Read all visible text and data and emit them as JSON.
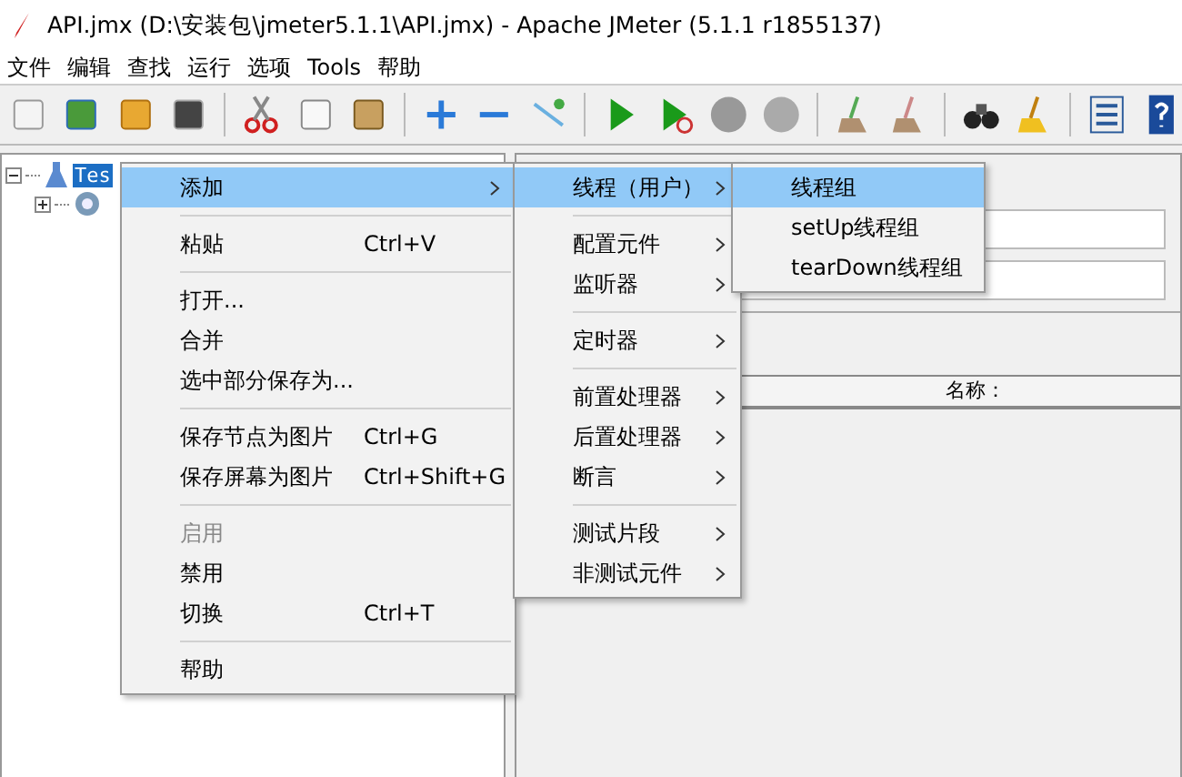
{
  "window": {
    "title": "API.jmx (D:\\安装包\\jmeter5.1.1\\API.jmx) - Apache JMeter (5.1.1 r1855137)"
  },
  "menu_bar": [
    "文件",
    "编辑",
    "查找",
    "运行",
    "选项",
    "Tools",
    "帮助"
  ],
  "tree": {
    "root": {
      "label": "Tes",
      "selected": true
    }
  },
  "table": {
    "columns": [
      "名称："
    ]
  },
  "context_menu": {
    "groups": [
      [
        {
          "label": "添加",
          "has_submenu": true,
          "selected": true,
          "disabled": false
        }
      ],
      [
        {
          "label": "粘贴",
          "shortcut": "Ctrl+V",
          "has_submenu": false,
          "selected": false,
          "disabled": false
        }
      ],
      [
        {
          "label": "打开...",
          "has_submenu": false,
          "selected": false,
          "disabled": false
        },
        {
          "label": "合并",
          "has_submenu": false,
          "selected": false,
          "disabled": false
        },
        {
          "label": "选中部分保存为...",
          "has_submenu": false,
          "selected": false,
          "disabled": false
        }
      ],
      [
        {
          "label": "保存节点为图片",
          "shortcut": "Ctrl+G",
          "has_submenu": false,
          "selected": false,
          "disabled": false
        },
        {
          "label": "保存屏幕为图片",
          "shortcut": "Ctrl+Shift+G",
          "has_submenu": false,
          "selected": false,
          "disabled": false
        }
      ],
      [
        {
          "label": "启用",
          "has_submenu": false,
          "selected": false,
          "disabled": true
        },
        {
          "label": "禁用",
          "has_submenu": false,
          "selected": false,
          "disabled": false
        },
        {
          "label": "切换",
          "shortcut": "Ctrl+T",
          "has_submenu": false,
          "selected": false,
          "disabled": false
        }
      ],
      [
        {
          "label": "帮助",
          "has_submenu": false,
          "selected": false,
          "disabled": false
        }
      ]
    ]
  },
  "submenu": {
    "groups": [
      [
        {
          "label": "线程（用户）",
          "has_submenu": true,
          "selected": true,
          "disabled": false
        }
      ],
      [
        {
          "label": "配置元件",
          "has_submenu": true,
          "selected": false,
          "disabled": false
        },
        {
          "label": "监听器",
          "has_submenu": true,
          "selected": false,
          "disabled": false
        }
      ],
      [
        {
          "label": "定时器",
          "has_submenu": true,
          "selected": false,
          "disabled": false
        }
      ],
      [
        {
          "label": "前置处理器",
          "has_submenu": true,
          "selected": false,
          "disabled": false
        },
        {
          "label": "后置处理器",
          "has_submenu": true,
          "selected": false,
          "disabled": false
        },
        {
          "label": "断言",
          "has_submenu": true,
          "selected": false,
          "disabled": false
        }
      ],
      [
        {
          "label": "测试片段",
          "has_submenu": true,
          "selected": false,
          "disabled": false
        },
        {
          "label": "非测试元件",
          "has_submenu": true,
          "selected": false,
          "disabled": false
        }
      ]
    ]
  },
  "thread_menu": {
    "groups": [
      [
        {
          "label": "线程组",
          "has_submenu": false,
          "selected": true,
          "disabled": false
        },
        {
          "label": "setUp线程组",
          "has_submenu": false,
          "selected": false,
          "disabled": false
        },
        {
          "label": "tearDown线程组",
          "has_submenu": false,
          "selected": false,
          "disabled": false
        }
      ]
    ]
  }
}
